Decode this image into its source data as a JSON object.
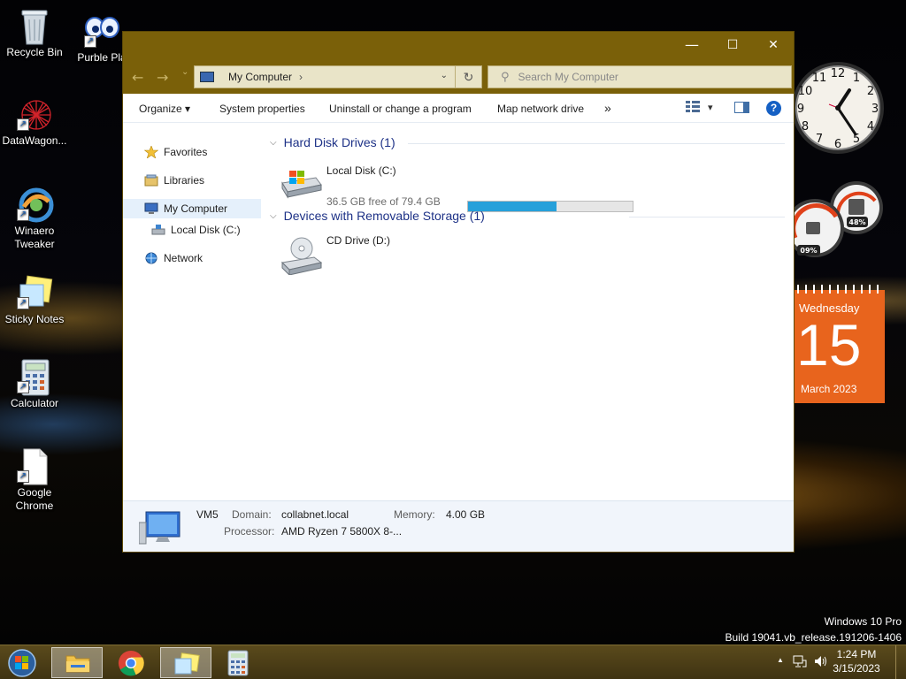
{
  "desktop": {
    "icons": [
      {
        "label": "Recycle Bin"
      },
      {
        "label": "Purble Pla"
      },
      {
        "label": "DataWagon..."
      },
      {
        "label": "Winaero Tweaker"
      },
      {
        "label": "Sticky Notes"
      },
      {
        "label": "Calculator"
      },
      {
        "label": "Google Chrome"
      }
    ],
    "watermark": {
      "line1": "Windows 10 Pro",
      "line2": "Build 19041.vb_release.191206-1406"
    }
  },
  "window": {
    "controls": {
      "minimize": "—",
      "maximize": "☐",
      "close": "✕"
    },
    "nav": {
      "back": "←",
      "forward": "→",
      "recent": "⌄"
    },
    "address": {
      "location": "My Computer",
      "separator": "›",
      "dropdown": "⌄",
      "refresh": "↻"
    },
    "search": {
      "placeholder": "Search My Computer"
    },
    "toolbar": {
      "organize": "Organize ▾",
      "system_properties": "System properties",
      "uninstall": "Uninstall or change a program",
      "map_drive": "Map network drive",
      "more": "»",
      "view_dropdown": "▾",
      "help": "?"
    },
    "navpane": {
      "favorites": "Favorites",
      "libraries": "Libraries",
      "my_computer": "My Computer",
      "local_disk": "Local Disk (C:)",
      "network": "Network"
    },
    "content": {
      "hdd_group": "Hard Disk Drives (1)",
      "removable_group": "Devices with Removable Storage (1)",
      "local_disk": {
        "name": "Local Disk (C:)",
        "free_text": "36.5 GB free of 79.4 GB",
        "used_fraction": 0.54
      },
      "cd_drive": {
        "name": "CD Drive (D:)"
      }
    },
    "details": {
      "name": "VM5",
      "domain_label": "Domain:",
      "domain_value": "collabnet.local",
      "memory_label": "Memory:",
      "memory_value": "4.00 GB",
      "processor_label": "Processor:",
      "processor_value": "AMD Ryzen 7 5800X 8-..."
    }
  },
  "gadgets": {
    "meters": {
      "cpu": "09%",
      "ram": "48%"
    },
    "calendar": {
      "weekday": "Wednesday",
      "day": "15",
      "month_year": "March 2023"
    }
  },
  "taskbar": {
    "tray": {
      "show_hidden": "▲",
      "time": "1:24 PM",
      "date": "3/15/2023"
    }
  }
}
